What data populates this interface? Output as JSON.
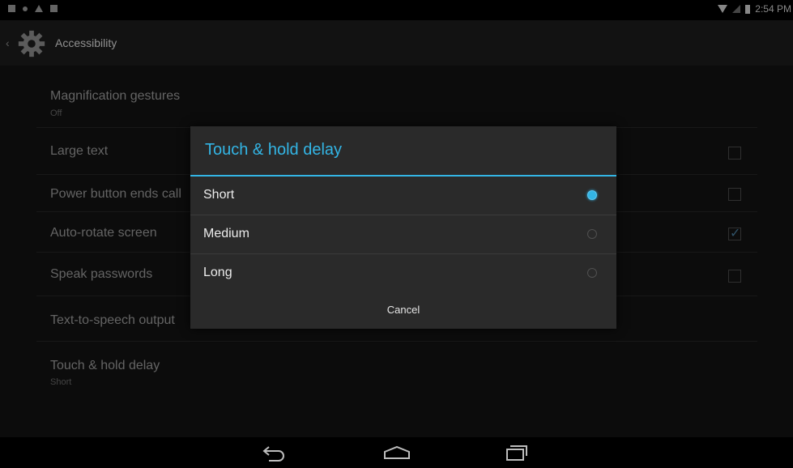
{
  "status_bar": {
    "time": "2:54 PM"
  },
  "action_bar": {
    "title": "Accessibility"
  },
  "settings": [
    {
      "title": "Magnification gestures",
      "subtitle": "Off",
      "checkbox": null
    },
    {
      "title": "Large text",
      "subtitle": "",
      "checkbox": false
    },
    {
      "title": "Power button ends call",
      "subtitle": "",
      "checkbox": false
    },
    {
      "title": "Auto-rotate screen",
      "subtitle": "",
      "checkbox": true
    },
    {
      "title": "Speak passwords",
      "subtitle": "",
      "checkbox": false
    },
    {
      "title": "Text-to-speech output",
      "subtitle": "",
      "checkbox": null
    },
    {
      "title": "Touch & hold delay",
      "subtitle": "Short",
      "checkbox": null
    }
  ],
  "dialog": {
    "title": "Touch & hold delay",
    "options": [
      {
        "label": "Short",
        "selected": true
      },
      {
        "label": "Medium",
        "selected": false
      },
      {
        "label": "Long",
        "selected": false
      }
    ],
    "cancel_label": "Cancel"
  },
  "colors": {
    "accent": "#33b5e5",
    "background": "#131313",
    "dialog": "#2a2a2a"
  }
}
